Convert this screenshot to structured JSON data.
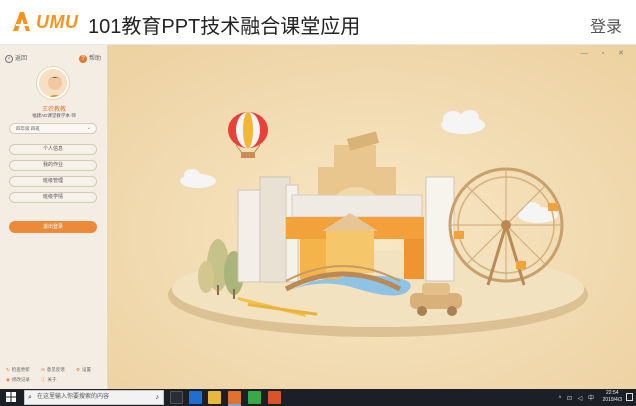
{
  "header": {
    "logo_text": "UMU",
    "title": "101教育PPT技术融合课堂应用",
    "login_label": "登录"
  },
  "panel": {
    "back_label": "返回",
    "help_label": "帮助",
    "username": "王农教教",
    "subline": "福建AD课堂教学本·师",
    "select_value": "四年级 四班",
    "menu": [
      {
        "label": "个人信息"
      },
      {
        "label": "我的作业"
      },
      {
        "label": "班级管理"
      },
      {
        "label": "班级学情"
      }
    ],
    "primary_label": "退出登录",
    "footer": [
      {
        "label": "检查更新",
        "icon": "refresh-icon"
      },
      {
        "label": "意见反馈",
        "icon": "feedback-icon"
      },
      {
        "label": "设置",
        "icon": "gear-icon"
      },
      {
        "label": "修改记录",
        "icon": "record-icon"
      },
      {
        "label": "关于",
        "icon": "info-icon"
      }
    ]
  },
  "window": {
    "controls": "— ▫ ✕"
  },
  "taskbar": {
    "search_placeholder": "在这里输入你要搜索的内容",
    "time": "22:54",
    "date": "2019/4/3",
    "tray": "^ ⊡ ◁ 中",
    "apps": [
      {
        "icon": "task-view-icon",
        "color": "#2a2d35"
      },
      {
        "icon": "edge-icon",
        "color": "#1f6fd0"
      },
      {
        "icon": "explorer-icon",
        "color": "#e6b840"
      },
      {
        "icon": "ppt-app-icon",
        "color": "#e0722e"
      },
      {
        "icon": "camtasia-icon",
        "color": "#3aa74a"
      },
      {
        "icon": "recorder-icon",
        "color": "#d9542d"
      }
    ]
  },
  "colors": {
    "accent": "#ec8a3a",
    "scene_bg": "#f2ddb4",
    "taskbar": "#1c1f26"
  }
}
